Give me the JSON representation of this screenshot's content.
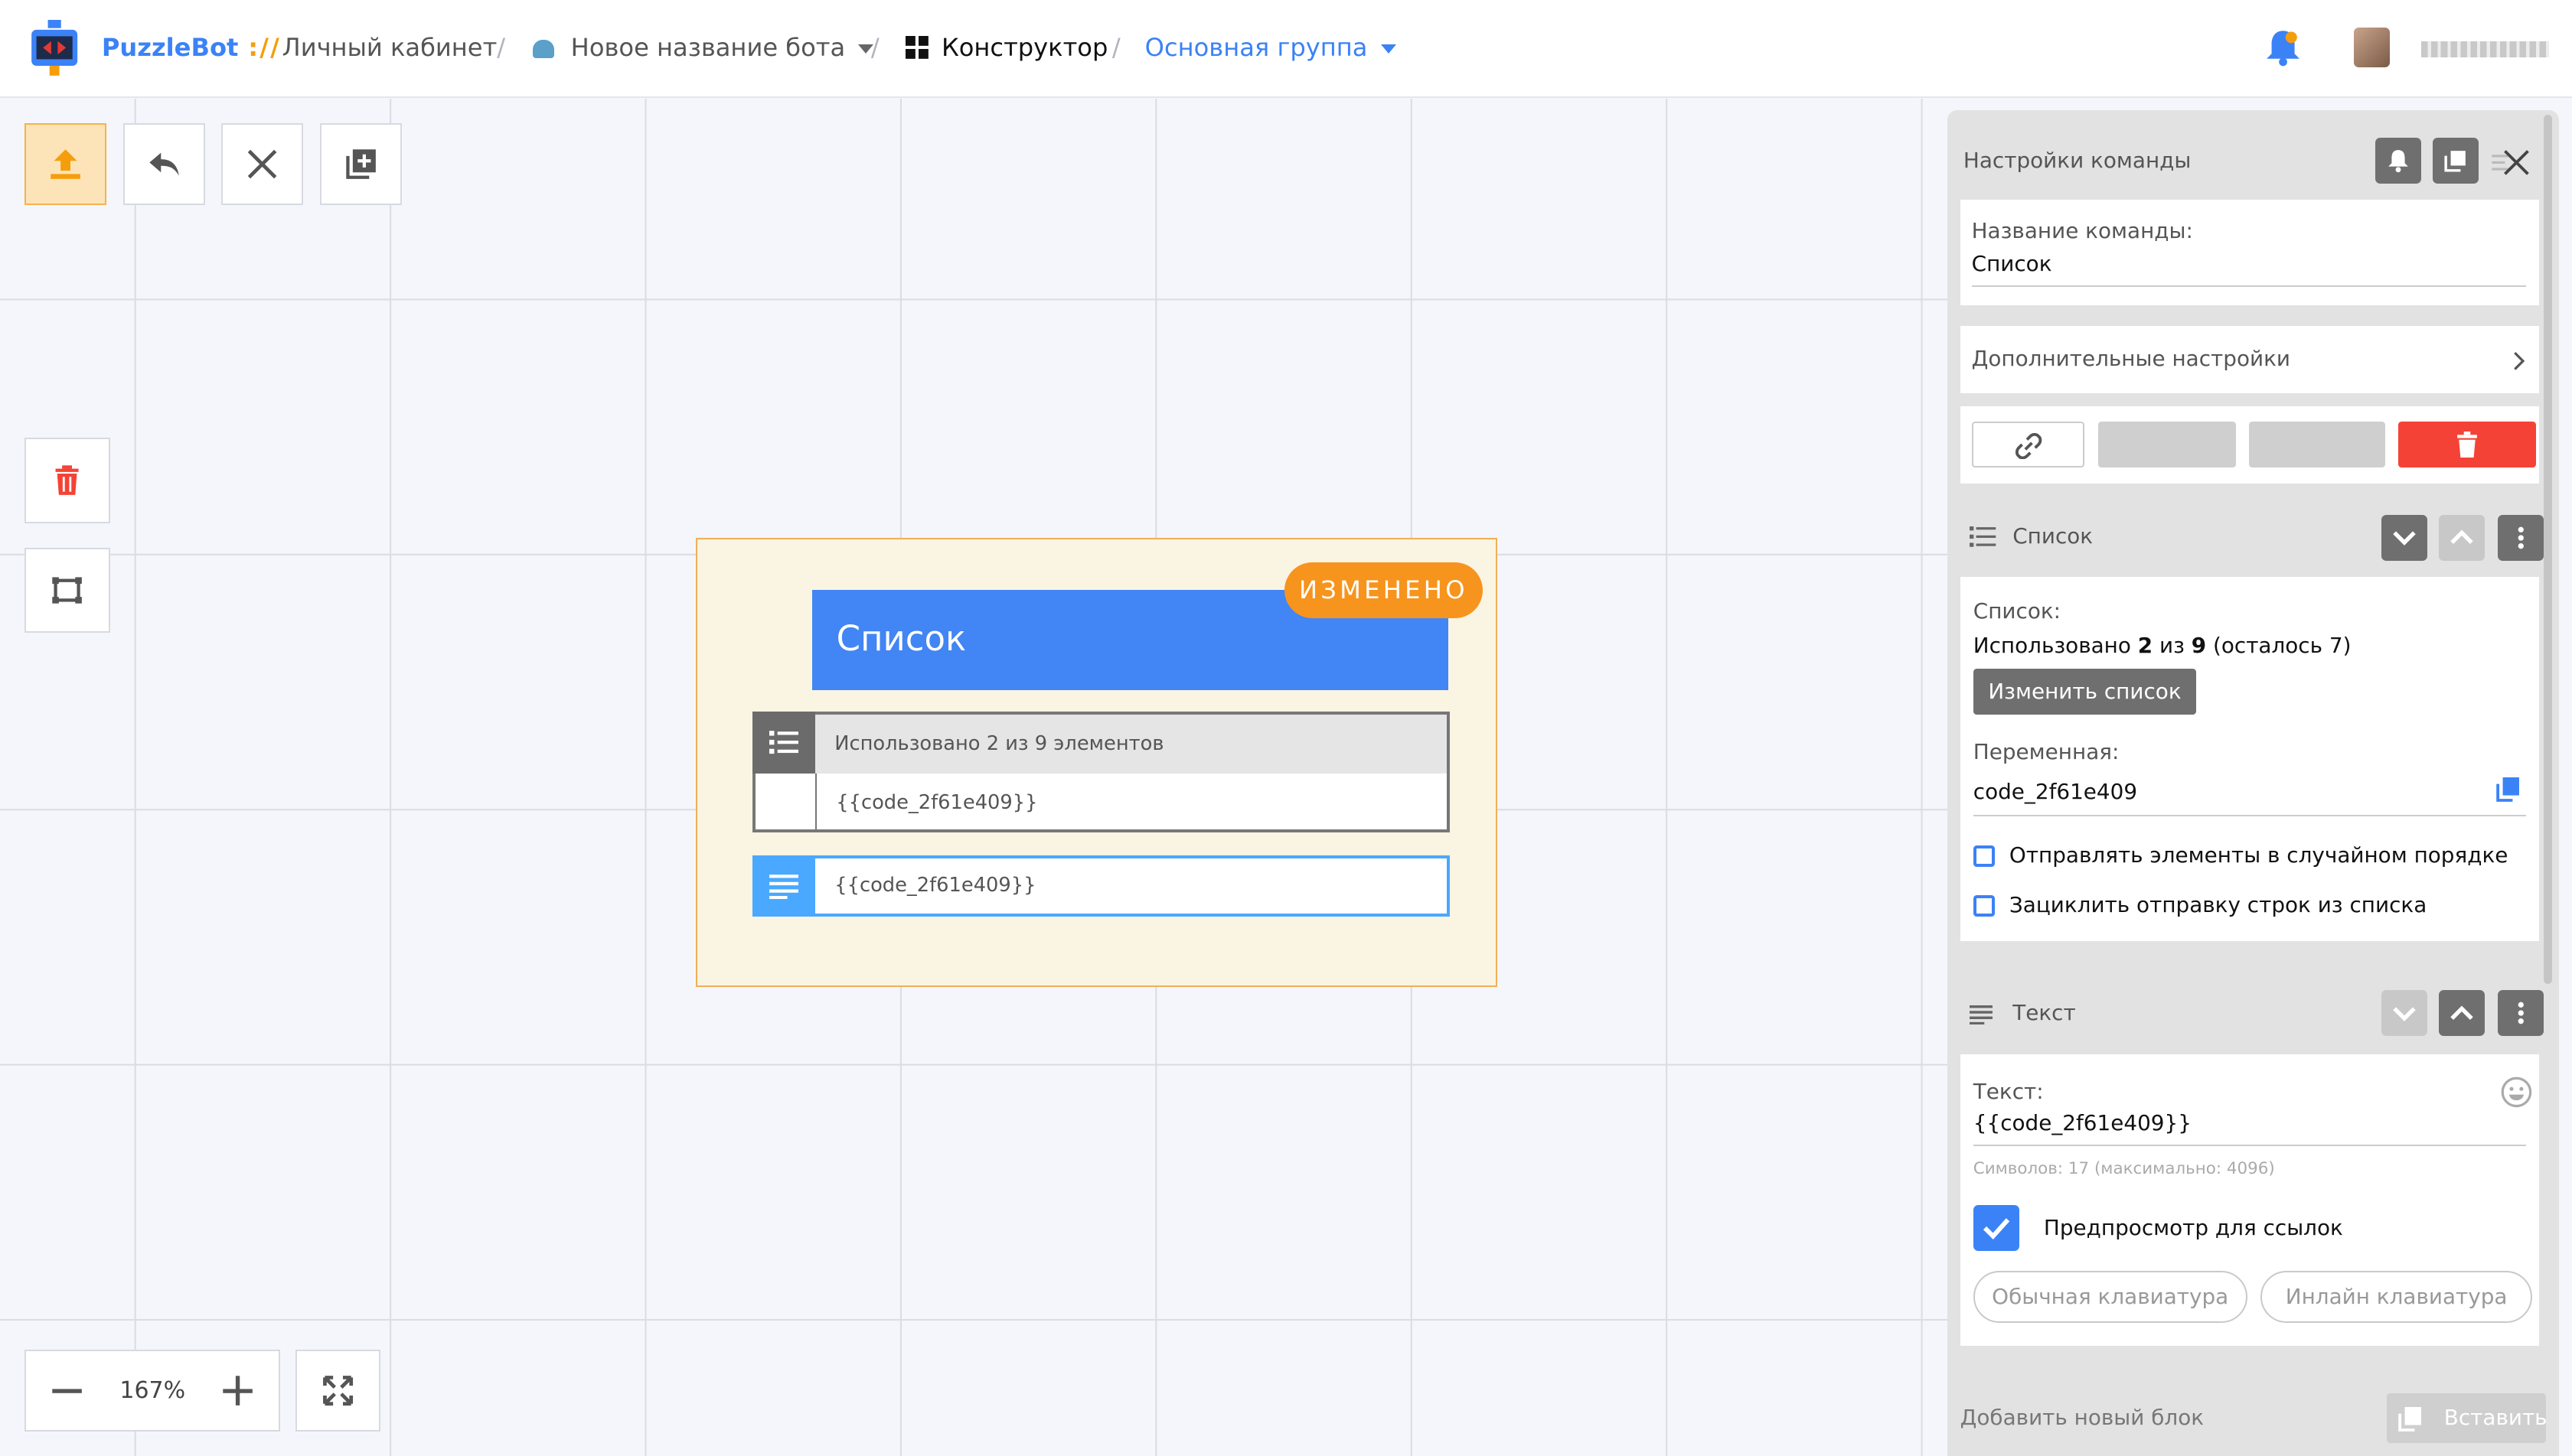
{
  "header": {
    "brand": "PuzzleBot",
    "brand_sep": "://",
    "crumb_cabinet": "Личный кабинет",
    "crumb_bot": "Новое название бота",
    "crumb_constructor": "Конструктор",
    "crumb_group": "Основная группа",
    "accent": "#3b82f6"
  },
  "toolbar": {
    "icons": [
      "upload-icon",
      "undo-icon",
      "close-icon",
      "add-block-icon",
      "trash-icon",
      "fit-icon"
    ]
  },
  "zoom": {
    "value": "167%"
  },
  "block": {
    "title": "Список",
    "badge": "ИЗМЕНЕНО",
    "list_summary": "Использовано 2 из 9 элементов",
    "list_var": "{{code_2f61e409}}",
    "text_value": "{{code_2f61e409}}"
  },
  "panel": {
    "title": "Настройки команды",
    "name_label": "Название команды:",
    "name_value": "Список",
    "advanced": "Дополнительные настройки",
    "list_section": "Список",
    "list_label": "Список:",
    "used_prefix": "Использовано ",
    "used_n": "2",
    "used_of": " из ",
    "used_total": "9",
    "used_suffix": " (осталось 7)",
    "change_list": "Изменить список",
    "var_label": "Переменная:",
    "var_value": "code_2f61e409",
    "random_order": "Отправлять элементы в случайном порядке",
    "loop_send": "Зациклить отправку строк из списка",
    "text_section": "Текст",
    "text_label": "Текст:",
    "text_value": "{{code_2f61e409}}",
    "chars": "Символов: 17 (максимально: 4096)",
    "link_preview": "Предпросмотр для ссылок",
    "link_preview_checked": true,
    "kb_normal": "Обычная клавиатура",
    "kb_inline": "Инлайн клавиатура",
    "add_block": "Добавить новый блок",
    "paste": "Вставить",
    "danger_color": "#f44336"
  }
}
